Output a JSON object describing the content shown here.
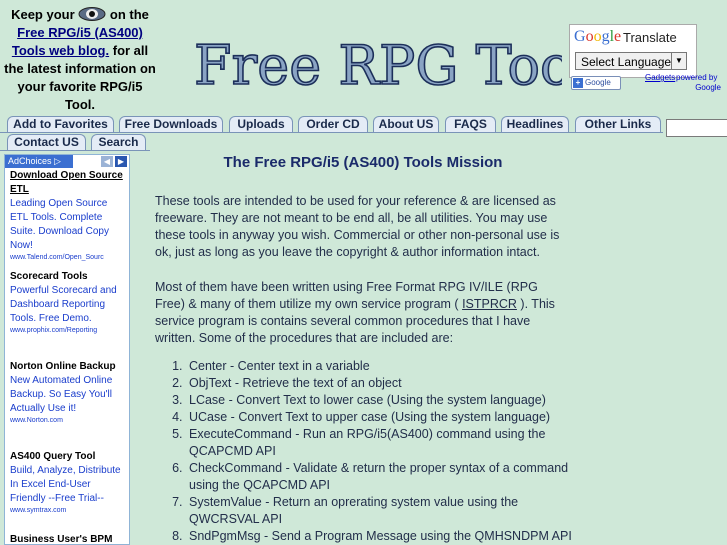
{
  "promo": {
    "line1_before": "Keep your",
    "line1_after": "on the",
    "link": "Free RPG/i5 (AS400) Tools web blog.",
    "rest": "for all the latest information on your favorite RPG/i5 Tool."
  },
  "logo": {
    "text": "Free RPG Tools"
  },
  "translate": {
    "brand": "Google",
    "label": "Translate",
    "select_value": "Select Language",
    "badge": "Google",
    "gadgets_link": "Gadgets",
    "powered_by": "powered by",
    "powered_name": "Google"
  },
  "nav": {
    "tabs": [
      "Add to Favorites",
      "Free Downloads",
      "Uploads",
      "Order CD",
      "About US",
      "FAQS",
      "Headlines",
      "Other Links",
      "Contact US",
      "Search"
    ]
  },
  "ads": {
    "adchoices": "AdChoices",
    "items": [
      {
        "title": "Download Open Source ETL",
        "desc": "Leading Open Source ETL Tools. Complete Suite. Download Copy Now!",
        "url": "www.Talend.com/Open_Sourc"
      },
      {
        "title": "Scorecard Tools",
        "desc": "Powerful Scorecard and Dashboard Reporting Tools. Free Demo.",
        "url": "www.prophix.com/Reporting"
      },
      {
        "title": "Norton Online Backup",
        "desc": "New Automated Online Backup. So Easy You'll Actually Use it!",
        "url": "www.Norton.com"
      },
      {
        "title": "AS400 Query Tool",
        "desc": "Build, Analyze, Distribute In Excel End-User Friendly --Free Trial--",
        "url": "www.symtrax.com"
      },
      {
        "title": "Business User's BPM",
        "desc": "",
        "url": ""
      }
    ]
  },
  "main": {
    "heading": "The Free RPG/i5 (AS400) Tools Mission",
    "para1": "These tools are intended to be used for your reference & are licensed as freeware. They are not meant to be end all, be all utilities. You may use these tools in anyway you wish. Commercial or other non-personal use is ok, just as long as you leave the copyright & author information intact.",
    "para2_before": "Most of them have been written using Free Format RPG IV/ILE (RPG Free) & many of them utilize my own service program (",
    "para2_link": "ISTPRCR",
    "para2_after": "). This service program is contains several common procedures that I have written. Some of the procedures that are included are:",
    "procedures": [
      "Center - Center text in a variable",
      "ObjText - Retrieve the text of an object",
      "LCase - Convert Text to lower case (Using the system language)",
      "UCase - Convert Text to upper case (Using the system language)",
      "ExecuteCommand - Run an RPG/i5(AS400) command using the QCAPCMD API",
      "CheckCommand - Validate & return the proper syntax of a command using the QCAPCMD API",
      "SystemValue - Return an oprerating system value using the QWCRSVAL API",
      "SndPgmMsg - Send a Program Message using the QMHSNDPM API"
    ]
  }
}
